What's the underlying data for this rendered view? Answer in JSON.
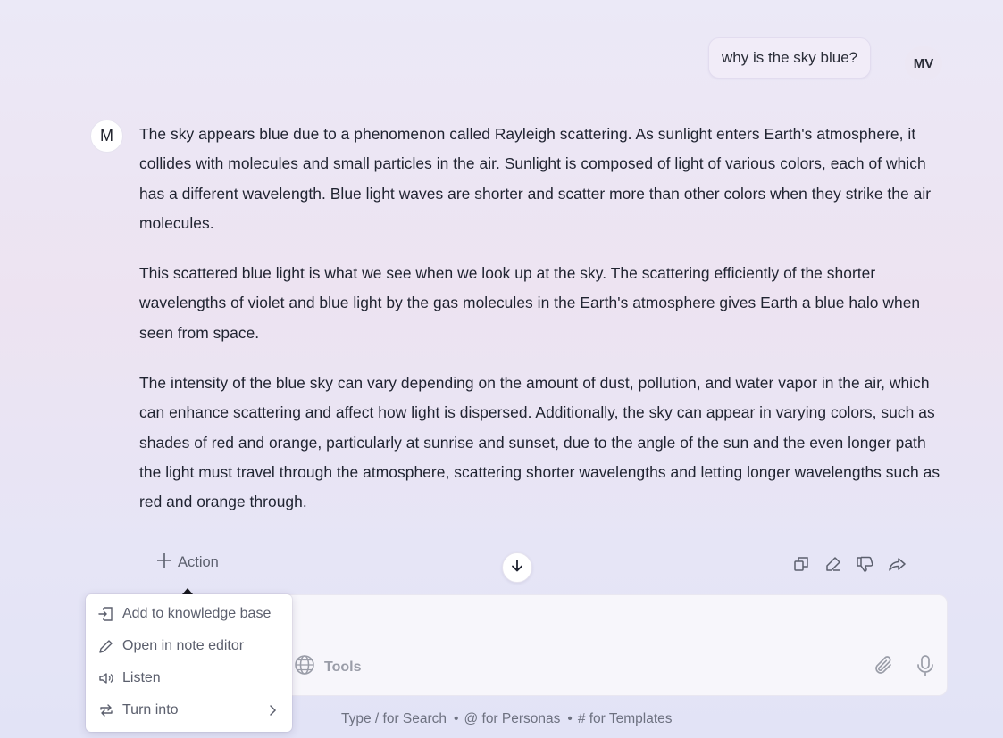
{
  "user_message": {
    "text": "why is the sky blue?",
    "avatar_initials": "MV"
  },
  "assistant": {
    "avatar_initial": "M",
    "paragraphs": [
      "The sky appears blue due to a phenomenon called Rayleigh scattering. As sunlight enters Earth's atmosphere, it collides with molecules and small particles in the air. Sunlight is composed of light of various colors, each of which has a different wavelength. Blue light waves are shorter and scatter more than other colors when they strike the air molecules.",
      "This scattered blue light is what we see when we look up at the sky. The scattering efficiently of the shorter wavelengths of violet and blue light by the gas molecules in the Earth's atmosphere gives Earth a blue halo when seen from space.",
      "The intensity of the blue sky can vary depending on the amount of dust, pollution, and water vapor in the air, which can enhance scattering and affect how light is dispersed. Additionally, the sky can appear in varying colors, such as shades of red and orange, particularly at sunrise and sunset, due to the angle of the sun and the even longer path the light must travel through the atmosphere, scattering shorter wavelengths and letting longer wavelengths such as red and orange through."
    ]
  },
  "action_bar": {
    "action_label": "Action",
    "tools": [
      {
        "icon": "copy-icon"
      },
      {
        "icon": "edit-icon"
      },
      {
        "icon": "thumbs-down-icon"
      },
      {
        "icon": "share-icon"
      }
    ]
  },
  "action_menu": {
    "items": [
      {
        "label": "Add to knowledge base",
        "icon": "knowledge-base-icon"
      },
      {
        "label": "Open in note editor",
        "icon": "pencil-icon"
      },
      {
        "label": "Listen",
        "icon": "speaker-icon"
      },
      {
        "label": "Turn into",
        "icon": "convert-icon",
        "has_submenu": true
      }
    ]
  },
  "composer": {
    "tools_label": "Tools",
    "hint": {
      "search": "Type / for Search",
      "personas": "@ for Personas",
      "templates": "# for Templates"
    }
  },
  "colors": {
    "text": "#1f2330",
    "muted": "#5b5f6d",
    "bg_top": "#ebe9f7",
    "bg_bottom": "#e2e3f6"
  }
}
